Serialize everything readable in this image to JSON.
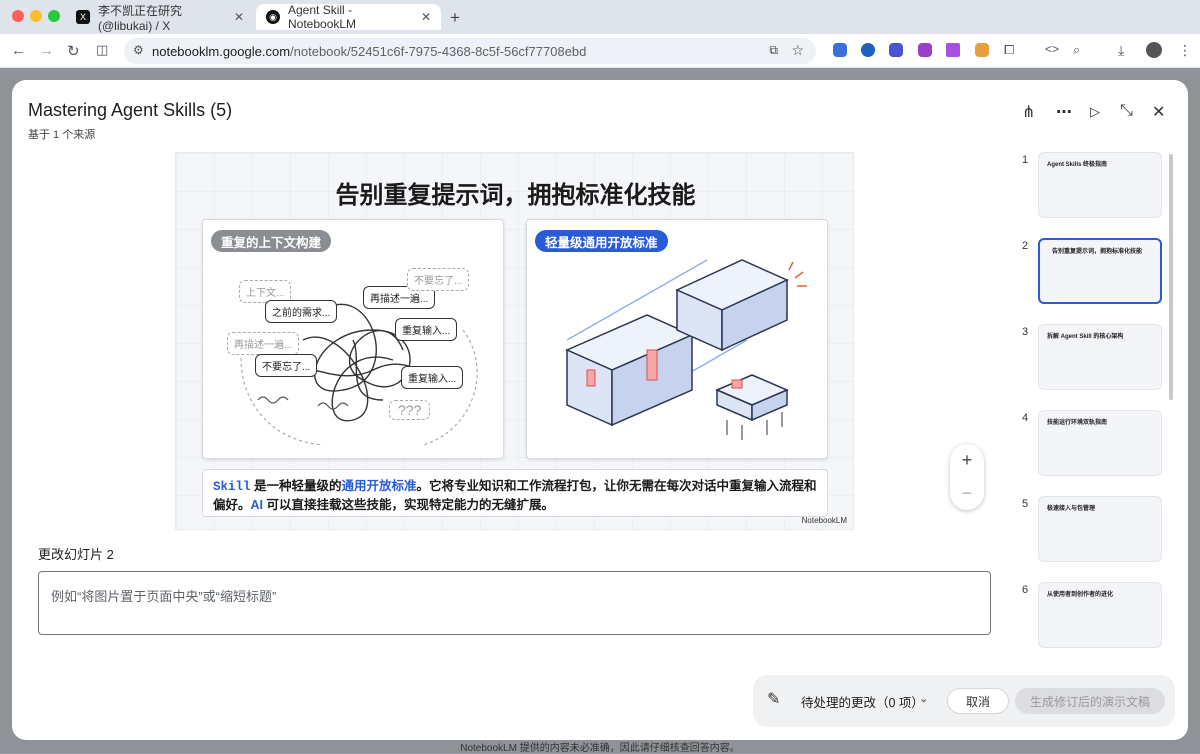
{
  "browser": {
    "tabs": [
      {
        "title": "李不凯正在研究 (@libukai) / X",
        "favicon": "X"
      },
      {
        "title": "Agent Skill - NotebookLM",
        "favicon": "nb"
      }
    ],
    "url_host": "notebooklm.google.com",
    "url_path": "/notebook/52451c6f-7975-4368-8c5f-56cf77708ebd"
  },
  "modal": {
    "title": "Mastering Agent Skills (5)",
    "subtitle": "基于 1 个来源"
  },
  "slide": {
    "title": "告别重复提示词，拥抱标准化技能",
    "left_pill": "重复的上下文构建",
    "right_pill": "轻量级通用开放标准",
    "bubbles": [
      "上下文...",
      "之前的需求...",
      "再描述一遍...",
      "重复输入...",
      "再描述一遍...",
      "不要忘了...",
      "重复输入...",
      "不要忘了..."
    ],
    "caption_pre": "Skill",
    "caption_1": " 是一种轻量级的",
    "caption_hl": "通用开放标准",
    "caption_2": "。它将专业知识和工作流程打包，让你无需在每次对话中重复输入流程和偏好。",
    "caption_ai": "AI",
    "caption_3": " 可以直接挂载这些技能，实现特定能力的无缝扩展。",
    "brand": "NotebookLM"
  },
  "edit": {
    "label": "更改幻灯片 2",
    "placeholder": "例如“将图片置于页面中央”或“缩短标题”"
  },
  "thumbnails": [
    {
      "num": "1",
      "title": "Agent Skills 终极指南"
    },
    {
      "num": "2",
      "title": "告别重复提示词，拥抱标准化技能"
    },
    {
      "num": "3",
      "title": "拆解 Agent Skill 的核心架构"
    },
    {
      "num": "4",
      "title": "技能运行环境双轨指南"
    },
    {
      "num": "5",
      "title": "极速接入与包管理"
    },
    {
      "num": "6",
      "title": "从使用者到创作者的进化"
    }
  ],
  "selected_thumbnail": "2",
  "actions": {
    "pending": "待处理的更改（0 项）",
    "cancel": "取消",
    "generate": "生成修订后的演示文稿"
  },
  "footer": "NotebookLM 提供的内容未必准确，因此请仔细核查回答内容。",
  "colors": {
    "accent": "#2a5bd7",
    "pill_gray": "#8a8d92"
  }
}
